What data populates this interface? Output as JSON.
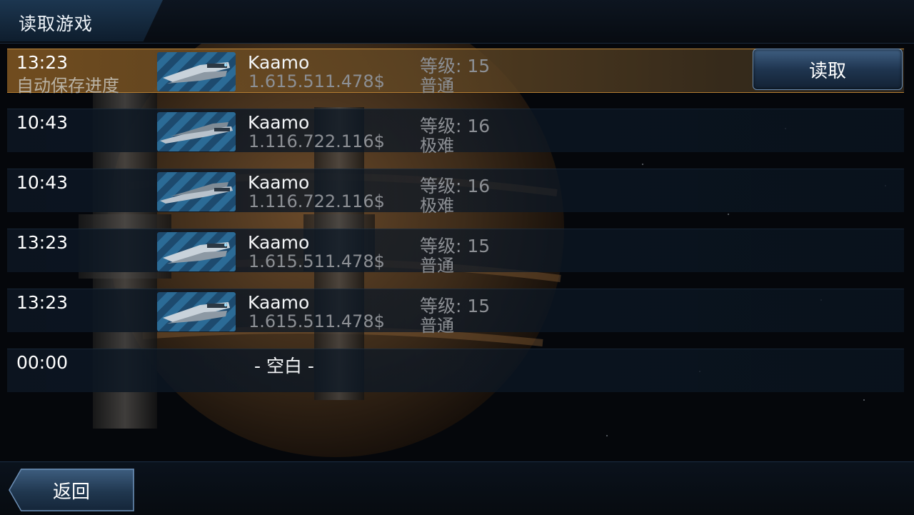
{
  "header": {
    "title": "读取游戏"
  },
  "saves": [
    {
      "time": "13:23",
      "subtitle": "自动保存进度",
      "name": "Kaamo",
      "money": "1.615.511.478$",
      "level": "等级: 15",
      "difficulty": "普通",
      "ship": "ship-a"
    },
    {
      "time": "10:43",
      "subtitle": "",
      "name": "Kaamo",
      "money": "1.116.722.116$",
      "level": "等级: 16",
      "difficulty": "极难",
      "ship": "ship-b"
    },
    {
      "time": "10:43",
      "subtitle": "",
      "name": "Kaamo",
      "money": "1.116.722.116$",
      "level": "等级: 16",
      "difficulty": "极难",
      "ship": "ship-b"
    },
    {
      "time": "13:23",
      "subtitle": "",
      "name": "Kaamo",
      "money": "1.615.511.478$",
      "level": "等级: 15",
      "difficulty": "普通",
      "ship": "ship-a"
    },
    {
      "time": "13:23",
      "subtitle": "",
      "name": "Kaamo",
      "money": "1.615.511.478$",
      "level": "等级: 15",
      "difficulty": "普通",
      "ship": "ship-a"
    },
    {
      "time": "00:00",
      "empty_label": "- 空白 -"
    }
  ],
  "buttons": {
    "load_label": "读取",
    "back_label": "返回"
  },
  "colors": {
    "selected_row": "#7a5424",
    "button_blue": "#2a4766",
    "accent_gold": "#c08a3c"
  }
}
